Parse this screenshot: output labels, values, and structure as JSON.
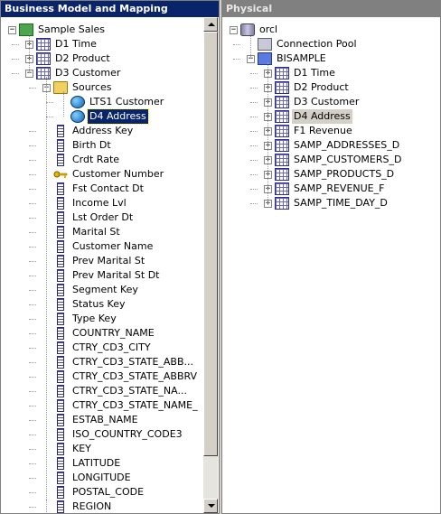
{
  "left_header": "Business Model and Mapping",
  "right_header": "Physical",
  "left_tree": [
    {
      "label": "Sample Sales",
      "level": 0,
      "exp": "−",
      "icon": "cube"
    },
    {
      "label": "D1 Time",
      "level": 1,
      "exp": "+",
      "icon": "table"
    },
    {
      "label": "D2 Product",
      "level": 1,
      "exp": "+",
      "icon": "table"
    },
    {
      "label": "D3 Customer",
      "level": 1,
      "exp": "−",
      "icon": "table"
    },
    {
      "label": "Sources",
      "level": 2,
      "exp": "−",
      "icon": "folder"
    },
    {
      "label": "LTS1 Customer",
      "level": 3,
      "exp": "",
      "icon": "globe"
    },
    {
      "label": "D4 Address",
      "level": 3,
      "exp": "",
      "icon": "globe",
      "selected": true
    },
    {
      "label": "Address Key",
      "level": 2,
      "exp": "",
      "icon": "column"
    },
    {
      "label": "Birth Dt",
      "level": 2,
      "exp": "",
      "icon": "column"
    },
    {
      "label": "Crdt Rate",
      "level": 2,
      "exp": "",
      "icon": "column"
    },
    {
      "label": "Customer Number",
      "level": 2,
      "exp": "",
      "icon": "key"
    },
    {
      "label": "Fst Contact Dt",
      "level": 2,
      "exp": "",
      "icon": "column"
    },
    {
      "label": "Income Lvl",
      "level": 2,
      "exp": "",
      "icon": "column"
    },
    {
      "label": "Lst Order Dt",
      "level": 2,
      "exp": "",
      "icon": "column"
    },
    {
      "label": "Marital St",
      "level": 2,
      "exp": "",
      "icon": "column"
    },
    {
      "label": "Customer Name",
      "level": 2,
      "exp": "",
      "icon": "column"
    },
    {
      "label": "Prev Marital St",
      "level": 2,
      "exp": "",
      "icon": "column"
    },
    {
      "label": "Prev Marital St Dt",
      "level": 2,
      "exp": "",
      "icon": "column"
    },
    {
      "label": "Segment Key",
      "level": 2,
      "exp": "",
      "icon": "column"
    },
    {
      "label": "Status Key",
      "level": 2,
      "exp": "",
      "icon": "column"
    },
    {
      "label": "Type Key",
      "level": 2,
      "exp": "",
      "icon": "column"
    },
    {
      "label": "COUNTRY_NAME",
      "level": 2,
      "exp": "",
      "icon": "column"
    },
    {
      "label": "CTRY_CD3_CITY",
      "level": 2,
      "exp": "",
      "icon": "column"
    },
    {
      "label": "CTRY_CD3_STATE_ABB...",
      "level": 2,
      "exp": "",
      "icon": "column"
    },
    {
      "label": "CTRY_CD3_STATE_ABBRV",
      "level": 2,
      "exp": "",
      "icon": "column"
    },
    {
      "label": "CTRY_CD3_STATE_NA...",
      "level": 2,
      "exp": "",
      "icon": "column"
    },
    {
      "label": "CTRY_CD3_STATE_NAME_",
      "level": 2,
      "exp": "",
      "icon": "column"
    },
    {
      "label": "ESTAB_NAME",
      "level": 2,
      "exp": "",
      "icon": "column"
    },
    {
      "label": "ISO_COUNTRY_CODE3",
      "level": 2,
      "exp": "",
      "icon": "column"
    },
    {
      "label": "KEY",
      "level": 2,
      "exp": "",
      "icon": "column"
    },
    {
      "label": "LATITUDE",
      "level": 2,
      "exp": "",
      "icon": "column"
    },
    {
      "label": "LONGITUDE",
      "level": 2,
      "exp": "",
      "icon": "column"
    },
    {
      "label": "POSTAL_CODE",
      "level": 2,
      "exp": "",
      "icon": "column"
    },
    {
      "label": "REGION",
      "level": 2,
      "exp": "",
      "icon": "column"
    }
  ],
  "right_tree": [
    {
      "label": "orcl",
      "level": 0,
      "exp": "−",
      "icon": "db"
    },
    {
      "label": "Connection Pool",
      "level": 1,
      "exp": "",
      "icon": "pool"
    },
    {
      "label": "BISAMPLE",
      "level": 1,
      "exp": "−",
      "icon": "schema"
    },
    {
      "label": "D1 Time",
      "level": 2,
      "exp": "+",
      "icon": "table"
    },
    {
      "label": "D2 Product",
      "level": 2,
      "exp": "+",
      "icon": "table"
    },
    {
      "label": "D3 Customer",
      "level": 2,
      "exp": "+",
      "icon": "table"
    },
    {
      "label": "D4 Address",
      "level": 2,
      "exp": "+",
      "icon": "table",
      "highlight": true
    },
    {
      "label": "F1 Revenue",
      "level": 2,
      "exp": "+",
      "icon": "table"
    },
    {
      "label": "SAMP_ADDRESSES_D",
      "level": 2,
      "exp": "+",
      "icon": "table"
    },
    {
      "label": "SAMP_CUSTOMERS_D",
      "level": 2,
      "exp": "+",
      "icon": "table"
    },
    {
      "label": "SAMP_PRODUCTS_D",
      "level": 2,
      "exp": "+",
      "icon": "table"
    },
    {
      "label": "SAMP_REVENUE_F",
      "level": 2,
      "exp": "+",
      "icon": "table"
    },
    {
      "label": "SAMP_TIME_DAY_D",
      "level": 2,
      "exp": "+",
      "icon": "table"
    }
  ]
}
